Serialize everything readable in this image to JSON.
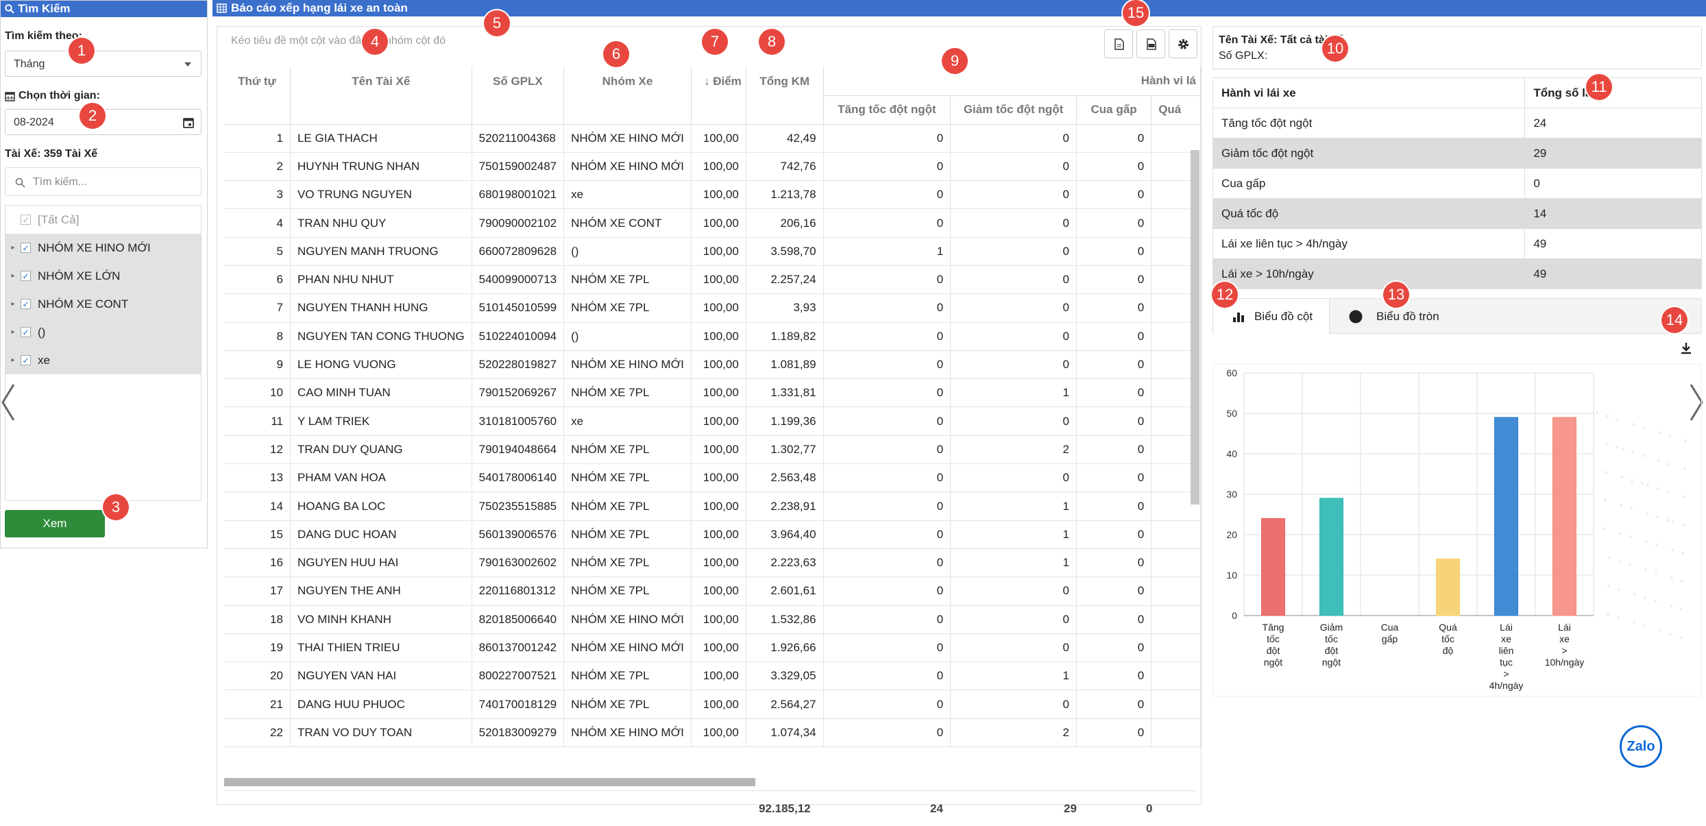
{
  "left": {
    "title": "Tìm Kiếm",
    "search_by_label": "Tìm kiếm theo:",
    "search_by_value": "Tháng",
    "time_label": "Chọn thời gian:",
    "time_value": "08-2024",
    "driver_label": "Tài Xế: 359 Tài Xế",
    "search_placeholder": "Tìm kiếm...",
    "tree": [
      {
        "label": "[Tất Cả]",
        "type": "all"
      },
      {
        "label": "NHÓM XE HINO MỚI",
        "type": "group"
      },
      {
        "label": "NHÓM XE LỚN",
        "type": "group"
      },
      {
        "label": "NHÓM XE CONT",
        "type": "group"
      },
      {
        "label": "()",
        "type": "group"
      },
      {
        "label": "xe",
        "type": "group"
      }
    ],
    "view_button": "Xem"
  },
  "main": {
    "title": "Báo cáo xếp hạng lái xe an toàn",
    "group_hint": "Kéo tiêu đề một cột vào đây để nhóm cột đó",
    "columns": {
      "stt": "Thứ tự",
      "name": "Tên Tài Xế",
      "gplx": "Số GPLX",
      "group": "Nhóm Xe",
      "score": "Điểm",
      "km": "Tổng KM",
      "behavior": "Hành vi lá",
      "accel": "Tăng tốc đột ngột",
      "brake": "Giảm tốc đột ngột",
      "turn": "Cua gấp",
      "speed": "Quá"
    },
    "rows": [
      {
        "stt": "1",
        "name": "LE GIA THACH",
        "gplx": "520211004368",
        "group": "NHÓM XE HINO MỚI",
        "score": "100,00",
        "km": "42,49",
        "a": "0",
        "b": "0",
        "c": "0"
      },
      {
        "stt": "2",
        "name": "HUYNH TRUNG NHAN",
        "gplx": "750159002487",
        "group": "NHÓM XE HINO MỚI",
        "score": "100,00",
        "km": "742,76",
        "a": "0",
        "b": "0",
        "c": "0"
      },
      {
        "stt": "3",
        "name": "VO TRUNG NGUYEN",
        "gplx": "680198001021",
        "group": "xe",
        "score": "100,00",
        "km": "1.213,78",
        "a": "0",
        "b": "0",
        "c": "0"
      },
      {
        "stt": "4",
        "name": "TRAN NHU QUY",
        "gplx": "790090002102",
        "group": "NHÓM XE CONT",
        "score": "100,00",
        "km": "206,16",
        "a": "0",
        "b": "0",
        "c": "0"
      },
      {
        "stt": "5",
        "name": "NGUYEN MANH TRUONG",
        "gplx": "660072809628",
        "group": "()",
        "score": "100,00",
        "km": "3.598,70",
        "a": "1",
        "b": "0",
        "c": "0"
      },
      {
        "stt": "6",
        "name": "PHAN NHU NHUT",
        "gplx": "540099000713",
        "group": "NHÓM XE 7PL",
        "score": "100,00",
        "km": "2.257,24",
        "a": "0",
        "b": "0",
        "c": "0"
      },
      {
        "stt": "7",
        "name": "NGUYEN THANH HUNG",
        "gplx": "510145010599",
        "group": "NHÓM XE 7PL",
        "score": "100,00",
        "km": "3,93",
        "a": "0",
        "b": "0",
        "c": "0"
      },
      {
        "stt": "8",
        "name": "NGUYEN TAN CONG THUONG",
        "gplx": "510224010094",
        "group": "()",
        "score": "100,00",
        "km": "1.189,82",
        "a": "0",
        "b": "0",
        "c": "0"
      },
      {
        "stt": "9",
        "name": "LE HONG VUONG",
        "gplx": "520228019827",
        "group": "NHÓM XE HINO MỚI",
        "score": "100,00",
        "km": "1.081,89",
        "a": "0",
        "b": "0",
        "c": "0"
      },
      {
        "stt": "10",
        "name": "CAO MINH TUAN",
        "gplx": "790152069267",
        "group": "NHÓM XE 7PL",
        "score": "100,00",
        "km": "1.331,81",
        "a": "0",
        "b": "1",
        "c": "0"
      },
      {
        "stt": "11",
        "name": "Y LAM TRIEK",
        "gplx": "310181005760",
        "group": "xe",
        "score": "100,00",
        "km": "1.199,36",
        "a": "0",
        "b": "0",
        "c": "0"
      },
      {
        "stt": "12",
        "name": "TRAN DUY QUANG",
        "gplx": "790194048664",
        "group": "NHÓM XE 7PL",
        "score": "100,00",
        "km": "1.302,77",
        "a": "0",
        "b": "2",
        "c": "0"
      },
      {
        "stt": "13",
        "name": "PHAM VAN HOA",
        "gplx": "540178006140",
        "group": "NHÓM XE 7PL",
        "score": "100,00",
        "km": "2.563,48",
        "a": "0",
        "b": "0",
        "c": "0"
      },
      {
        "stt": "14",
        "name": "HOANG BA LOC",
        "gplx": "750235515885",
        "group": "NHÓM XE 7PL",
        "score": "100,00",
        "km": "2.238,91",
        "a": "0",
        "b": "1",
        "c": "0"
      },
      {
        "stt": "15",
        "name": "DANG DUC HOAN",
        "gplx": "560139006576",
        "group": "NHÓM XE 7PL",
        "score": "100,00",
        "km": "3.964,40",
        "a": "0",
        "b": "1",
        "c": "0"
      },
      {
        "stt": "16",
        "name": "NGUYEN HUU HAI",
        "gplx": "790163002602",
        "group": "NHÓM XE 7PL",
        "score": "100,00",
        "km": "2.223,63",
        "a": "0",
        "b": "1",
        "c": "0"
      },
      {
        "stt": "17",
        "name": "NGUYEN THE ANH",
        "gplx": "220116801312",
        "group": "NHÓM XE 7PL",
        "score": "100,00",
        "km": "2.601,61",
        "a": "0",
        "b": "0",
        "c": "0"
      },
      {
        "stt": "18",
        "name": "VO MINH KHANH",
        "gplx": "820185006640",
        "group": "NHÓM XE HINO MỚI",
        "score": "100,00",
        "km": "1.532,86",
        "a": "0",
        "b": "0",
        "c": "0"
      },
      {
        "stt": "19",
        "name": "THAI THIEN TRIEU",
        "gplx": "860137001242",
        "group": "NHÓM XE HINO MỚI",
        "score": "100,00",
        "km": "1.926,66",
        "a": "0",
        "b": "0",
        "c": "0"
      },
      {
        "stt": "20",
        "name": "NGUYEN VAN HAI",
        "gplx": "800227007521",
        "group": "NHÓM XE 7PL",
        "score": "100,00",
        "km": "3.329,05",
        "a": "0",
        "b": "1",
        "c": "0"
      },
      {
        "stt": "21",
        "name": "DANG HUU PHUOC",
        "gplx": "740170018129",
        "group": "NHÓM XE 7PL",
        "score": "100,00",
        "km": "2.564,27",
        "a": "0",
        "b": "0",
        "c": "0"
      },
      {
        "stt": "22",
        "name": "TRAN VO DUY TOAN",
        "gplx": "520183009279",
        "group": "NHÓM XE HINO MỚI",
        "score": "100,00",
        "km": "1.074,34",
        "a": "0",
        "b": "2",
        "c": "0"
      }
    ],
    "footer": {
      "km": "92.185,12",
      "accel": "24",
      "brake": "29",
      "turn": "0"
    }
  },
  "right": {
    "driver_name": "Tên Tài Xế: Tất cả tài xế",
    "gplx": "Số GPLX:",
    "summary_headers": [
      "Hành vi lái xe",
      "Tổng số lần"
    ],
    "summary_rows": [
      {
        "label": "Tăng tốc đột ngột",
        "value": "24"
      },
      {
        "label": "Giảm tốc đột ngột",
        "value": "29"
      },
      {
        "label": "Cua gấp",
        "value": "0"
      },
      {
        "label": "Quá tốc độ",
        "value": "14"
      },
      {
        "label": "Lái xe liên tục > 4h/ngày",
        "value": "49"
      },
      {
        "label": "Lái xe > 10h/ngày",
        "value": "49"
      }
    ],
    "tab_bar": "Biểu đồ cột",
    "tab_pie": "Biểu đồ tròn"
  },
  "badges": [
    "1",
    "2",
    "3",
    "4",
    "5",
    "6",
    "7",
    "8",
    "9",
    "10",
    "11",
    "12",
    "13",
    "14",
    "15"
  ],
  "zalo": "Zalo",
  "chart_data": {
    "type": "bar",
    "categories": [
      "Tăng tốc đột ngột",
      "Giảm tốc đột ngột",
      "Cua gấp",
      "Quá tốc độ",
      "Lái xe liên tục > 4h/ngày",
      "Lái xe > 10h/ngày"
    ],
    "category_lines": [
      [
        "Tăng",
        "tốc",
        "đột",
        "ngột"
      ],
      [
        "Giảm",
        "tốc",
        "đột",
        "ngột"
      ],
      [
        "Cua",
        "gấp"
      ],
      [
        "Quá",
        "tốc",
        "độ"
      ],
      [
        "Lái",
        "xe",
        "liên",
        "tục",
        ">",
        "4h/ngày"
      ],
      [
        "Lái",
        "xe",
        ">",
        "10h/ngày"
      ]
    ],
    "values": [
      24,
      29,
      0,
      14,
      49,
      49
    ],
    "colors": [
      "#e8625e",
      "#2bb8b3",
      "#999999",
      "#f6cf6a",
      "#2f7fd0",
      "#f58b80"
    ],
    "ylim": [
      0,
      60
    ],
    "yticks": [
      0,
      10,
      20,
      30,
      40,
      50,
      60
    ],
    "grid": true
  }
}
